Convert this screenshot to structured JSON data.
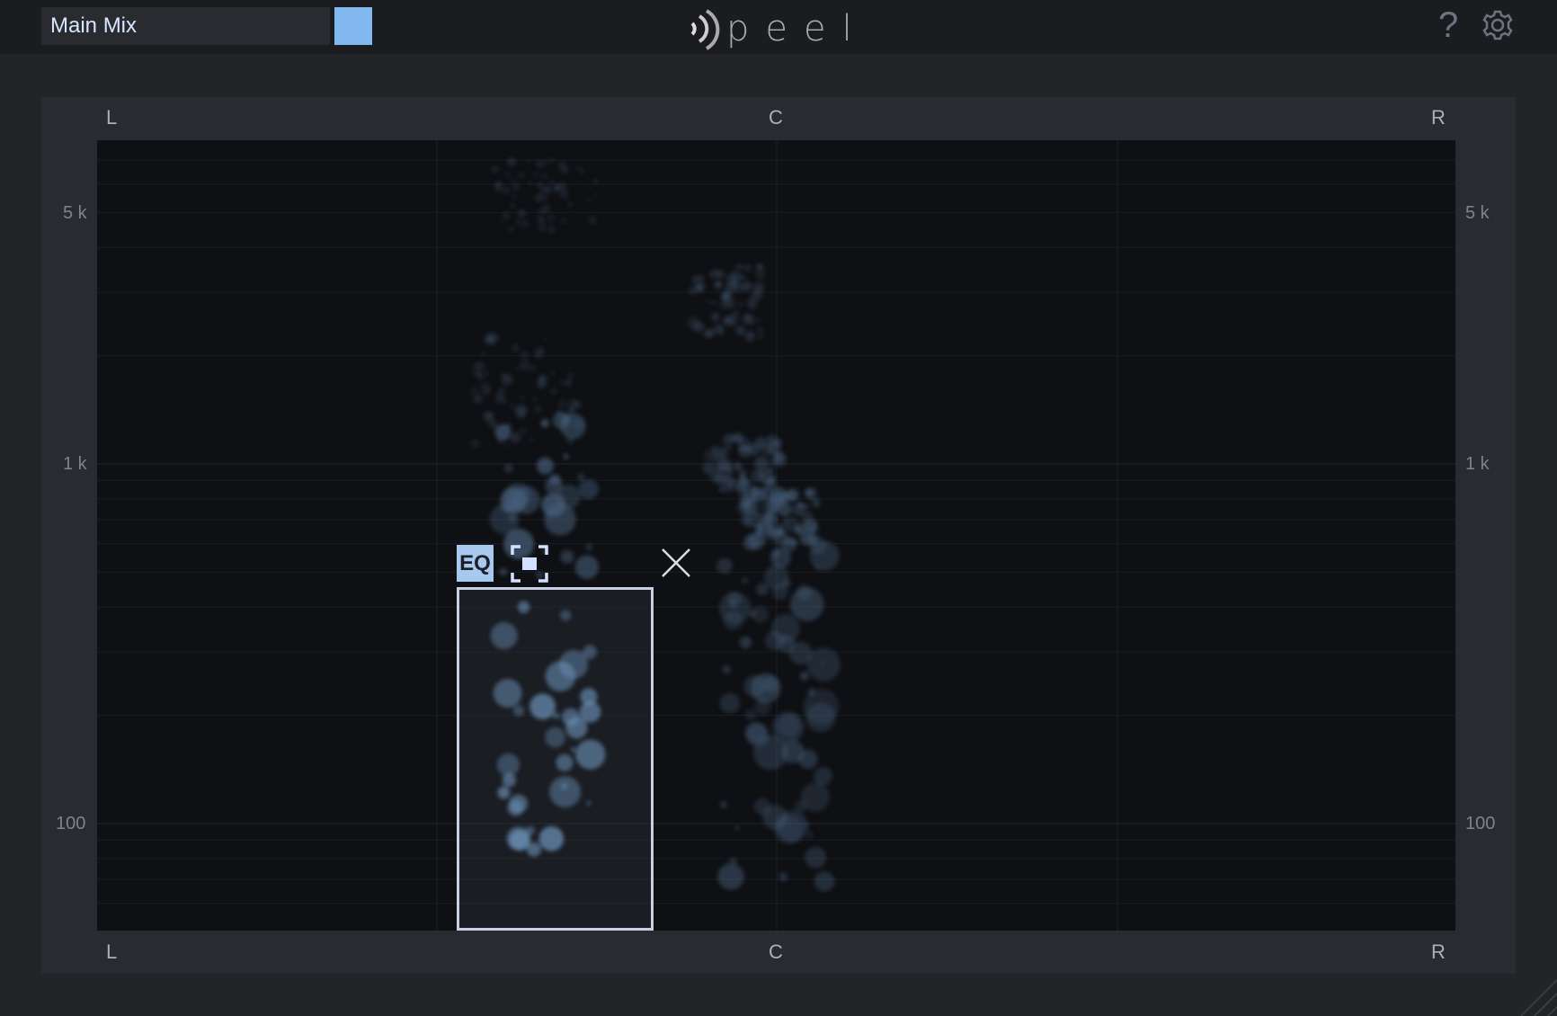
{
  "header": {
    "mix_name": "Main Mix",
    "mix_color": "#82b8f0",
    "logo_text": "peel",
    "help_label": "?",
    "icons": [
      "help-icon",
      "gear-icon"
    ]
  },
  "panel": {
    "pan_labels": {
      "left": "L",
      "center": "C",
      "right": "R"
    },
    "freq_labels": [
      "5 k",
      "1 k",
      "100"
    ],
    "selection": {
      "eq_label": "EQ",
      "icons": [
        "focus-icon",
        "close-icon"
      ]
    }
  },
  "colors": {
    "accent": "#82b8f0",
    "background": "#0f1013"
  }
}
